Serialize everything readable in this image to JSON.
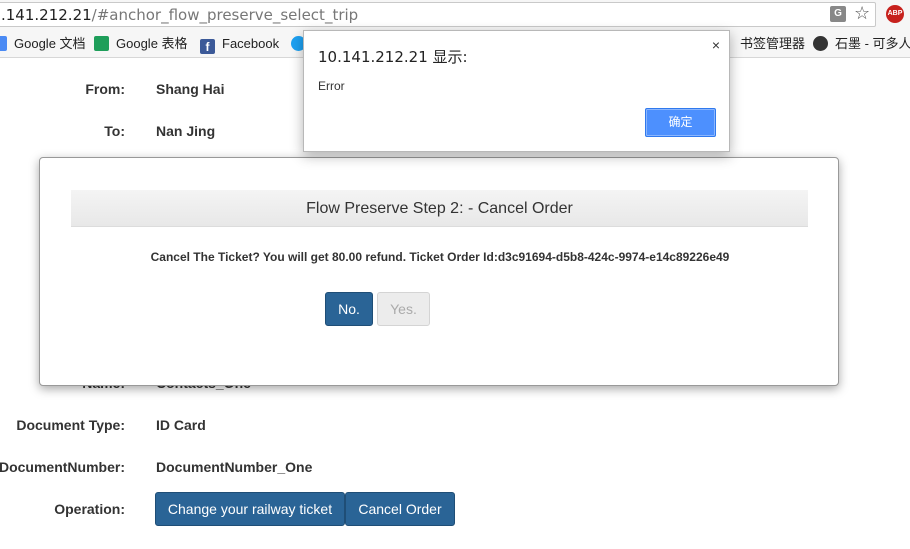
{
  "browser": {
    "url_host": ".141.212.21",
    "url_path": "/#anchor_flow_preserve_select_trip",
    "translate_icon_text": "G",
    "abp_text": "ABP",
    "bookmarks": [
      {
        "label": "Google 文档",
        "icon": "google-docs-icon"
      },
      {
        "label": "Google 表格",
        "icon": "google-sheets-icon"
      },
      {
        "label": "Facebook",
        "icon": "facebook-icon"
      },
      {
        "label": "",
        "icon": "twitter-icon"
      },
      {
        "label": "书签管理器",
        "icon": ""
      },
      {
        "label": "石墨 - 可多人实",
        "icon": "shimo-icon"
      }
    ]
  },
  "form": {
    "from_label": "From:",
    "from_value": "Shang Hai",
    "to_label": "To:",
    "to_value": "Nan Jing",
    "name_label": "Name:",
    "name_value": "Contacts_One",
    "doc_type_label": "Document Type:",
    "doc_type_value": "ID Card",
    "doc_number_label": "DocumentNumber:",
    "doc_number_value": "DocumentNumber_One",
    "operation_label": "Operation:",
    "change_button": "Change your railway ticket",
    "cancel_button": "Cancel Order"
  },
  "modal": {
    "title": "Flow Preserve Step 2: - Cancel Order",
    "message": "Cancel The Ticket? You will get 80.00 refund. Ticket Order Id:d3c91694-d5b8-424c-9974-e14c89226e49",
    "no_button": "No.",
    "yes_button": "Yes."
  },
  "alert": {
    "title": "10.141.212.21 显示:",
    "message": "Error",
    "ok_button": "确定",
    "close_glyph": "×"
  }
}
